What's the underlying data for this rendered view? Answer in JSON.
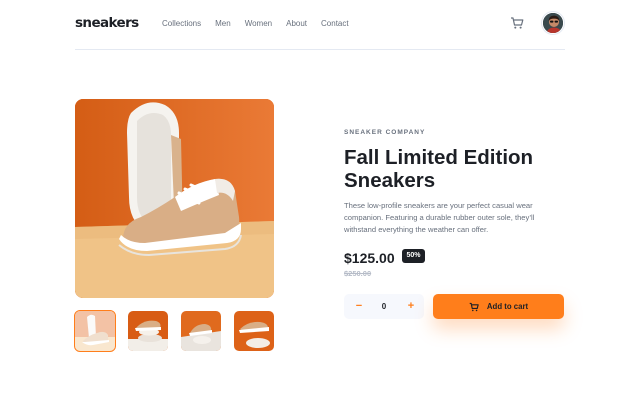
{
  "brand": {
    "logo": "sneakers"
  },
  "nav": {
    "items": [
      "Collections",
      "Men",
      "Women",
      "About",
      "Contact"
    ]
  },
  "header": {
    "cart_icon": "cart-icon",
    "avatar": "user-avatar"
  },
  "product": {
    "company": "SNEAKER COMPANY",
    "title": "Fall Limited Edition Sneakers",
    "description": "These low-profile sneakers are your perfect casual wear companion. Featuring a durable rubber outer sole, they’ll withstand everything the weather can offer.",
    "price": "$125.00",
    "discount": "50%",
    "original_price": "$250.00"
  },
  "cart": {
    "quantity": "0",
    "minus_symbol": "−",
    "plus_symbol": "+",
    "add_label": "Add to cart"
  },
  "gallery": {
    "thumbnails": 4,
    "active_thumbnail": 1
  },
  "colors": {
    "accent": "#ff7e1b",
    "dark": "#1d2026",
    "muted": "#68707d",
    "pale": "#b6bcc8"
  }
}
